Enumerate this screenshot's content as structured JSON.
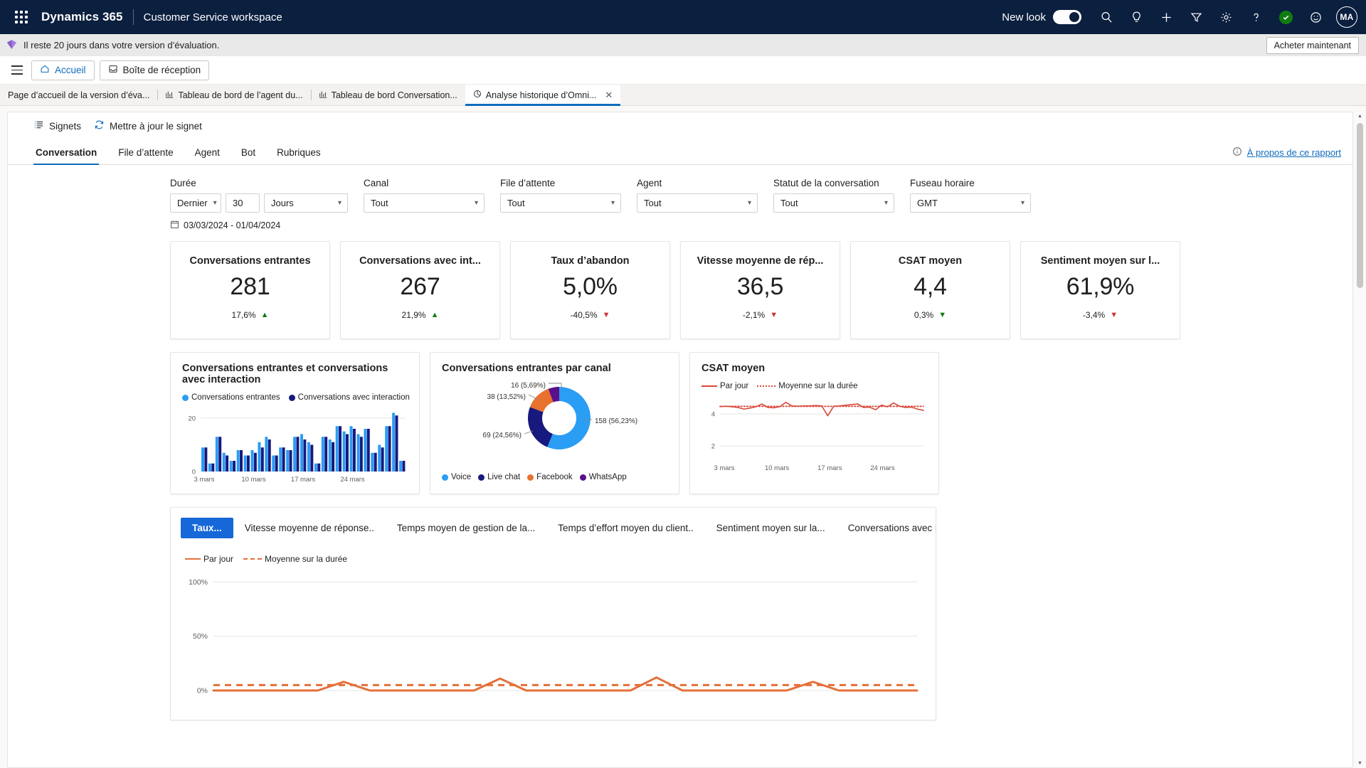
{
  "topbar": {
    "waffle_label": "app-launcher",
    "brand": "Dynamics 365",
    "app_name": "Customer Service workspace",
    "new_look_label": "New look",
    "new_look_on": true,
    "avatar_initials": "MA",
    "icons": [
      "search-icon",
      "lightbulb-icon",
      "plus-icon",
      "filter-icon",
      "gear-icon",
      "help-icon",
      "status-check-icon",
      "smiley-icon"
    ]
  },
  "trial": {
    "message": "Il reste 20 jours dans votre version d’évaluation.",
    "buy_label": "Acheter maintenant"
  },
  "appnav": {
    "home_label": "Accueil",
    "inbox_label": "Boîte de réception"
  },
  "session_tabs": [
    {
      "label": "Page d’accueil de la version d’éva...",
      "icon": "",
      "active": false,
      "closable": false
    },
    {
      "label": "Tableau de bord de l’agent du...",
      "icon": "dashboard-icon",
      "active": false,
      "closable": false
    },
    {
      "label": "Tableau de bord Conversation...",
      "icon": "dashboard-icon",
      "active": false,
      "closable": false
    },
    {
      "label": "Analyse historique d’Omni...",
      "icon": "analytics-icon",
      "active": true,
      "closable": true
    }
  ],
  "commandbar": {
    "bookmarks_label": "Signets",
    "refresh_label": "Mettre à jour le signet"
  },
  "report_tabs": [
    {
      "label": "Conversation",
      "active": true
    },
    {
      "label": "File d’attente",
      "active": false
    },
    {
      "label": "Agent",
      "active": false
    },
    {
      "label": "Bot",
      "active": false
    },
    {
      "label": "Rubriques",
      "active": false
    }
  ],
  "about_report": "À propos de ce rapport",
  "filters": {
    "duration": {
      "label": "Durée",
      "relative": "Dernier",
      "amount": "30",
      "unit": "Jours"
    },
    "channel": {
      "label": "Canal",
      "value": "Tout"
    },
    "queue": {
      "label": "File d’attente",
      "value": "Tout"
    },
    "agent": {
      "label": "Agent",
      "value": "Tout"
    },
    "status": {
      "label": "Statut de la conversation",
      "value": "Tout"
    },
    "timezone": {
      "label": "Fuseau horaire",
      "value": "GMT"
    },
    "date_range": "03/03/2024 - 01/04/2024"
  },
  "kpis": [
    {
      "title": "Conversations entrantes",
      "value": "281",
      "delta": "17,6%",
      "direction": "up",
      "arrow": "▲"
    },
    {
      "title": "Conversations avec int...",
      "value": "267",
      "delta": "21,9%",
      "direction": "up",
      "arrow": "▲"
    },
    {
      "title": "Taux d’abandon",
      "value": "5,0%",
      "delta": "-40,5%",
      "direction": "down-red",
      "arrow": "▼"
    },
    {
      "title": "Vitesse moyenne de rép...",
      "value": "36,5",
      "delta": "-2,1%",
      "direction": "down-red",
      "arrow": "▼"
    },
    {
      "title": "CSAT moyen",
      "value": "4,4",
      "delta": "0,3%",
      "direction": "down-green",
      "arrow": "▼"
    },
    {
      "title": "Sentiment moyen sur l...",
      "value": "61,9%",
      "delta": "-3,4%",
      "direction": "down-red",
      "arrow": "▼"
    }
  ],
  "colors": {
    "accent": "#0f6cbd",
    "series_light_blue": "#2a9df4",
    "series_dark_blue": "#17197e",
    "series_orange": "#e8712e",
    "series_purple": "#5c0f8b",
    "line_red": "#d9483b",
    "line_orange": "#e4703a",
    "up_green": "#107c10",
    "down_red": "#d13438",
    "pivot_active": "#1668d8",
    "topbar_bg": "#0b1f3f"
  },
  "chart_data": [
    {
      "type": "bar",
      "title": "Conversations entrantes et conversations avec interaction",
      "xlabel": "",
      "ylabel": "",
      "ylim": [
        0,
        24
      ],
      "yticks": [
        "0",
        "20"
      ],
      "grid": true,
      "legend_position": "top",
      "categories": [
        "3 mars",
        "4 mars",
        "5 mars",
        "6 mars",
        "7 mars",
        "8 mars",
        "9 mars",
        "10 mars",
        "11 mars",
        "12 mars",
        "13 mars",
        "14 mars",
        "15 mars",
        "16 mars",
        "17 mars",
        "18 mars",
        "19 mars",
        "20 mars",
        "21 mars",
        "22 mars",
        "23 mars",
        "24 mars",
        "25 mars",
        "26 mars",
        "27 mars",
        "28 mars",
        "29 mars",
        "30 mars"
      ],
      "tick_labels": [
        "3 mars",
        "10 mars",
        "17 mars",
        "24 mars"
      ],
      "series": [
        {
          "name": "Conversations entrantes",
          "color": "#2a9df4",
          "values": [
            9,
            3,
            13,
            7,
            4,
            8,
            6,
            8,
            11,
            13,
            6,
            9,
            8,
            13,
            14,
            11,
            3,
            13,
            12,
            17,
            15,
            17,
            14,
            16,
            7,
            10,
            17,
            22,
            4
          ]
        },
        {
          "name": "Conversations avec interaction",
          "color": "#17197e",
          "values": [
            9,
            3,
            13,
            6,
            4,
            8,
            6,
            7,
            9,
            12,
            6,
            9,
            8,
            13,
            12,
            10,
            3,
            13,
            11,
            17,
            14,
            16,
            13,
            16,
            7,
            9,
            17,
            21,
            4
          ]
        }
      ]
    },
    {
      "type": "pie",
      "title": "Conversations entrantes par canal",
      "donut": true,
      "legend_position": "bottom",
      "labels": [
        "Voice",
        "Live chat",
        "Facebook",
        "WhatsApp"
      ],
      "values": [
        158,
        69,
        38,
        16
      ],
      "percents": [
        "56,23%",
        "24,56%",
        "13,52%",
        "5,69%"
      ],
      "data_labels": [
        "158 (56,23%)",
        "69 (24,56%)",
        "38 (13,52%)",
        "16 (5,69%)"
      ],
      "colors": [
        "#2a9df4",
        "#17197e",
        "#e8712e",
        "#5c0f8b"
      ]
    },
    {
      "type": "line",
      "title": "CSAT moyen",
      "ylim": [
        1.2,
        5.2
      ],
      "yticks": [
        "2",
        "4"
      ],
      "tick_labels": [
        "3 mars",
        "10 mars",
        "17 mars",
        "24 mars"
      ],
      "legend_position": "top",
      "series": [
        {
          "name": "Par jour",
          "style": "solid",
          "color": "#d9483b",
          "values": [
            4.45,
            4.48,
            4.44,
            4.4,
            4.3,
            4.36,
            4.44,
            4.62,
            4.4,
            4.38,
            4.45,
            4.72,
            4.5,
            4.48,
            4.5,
            4.5,
            4.52,
            4.5,
            3.88,
            4.48,
            4.5,
            4.54,
            4.58,
            4.62,
            4.4,
            4.42,
            4.26,
            4.55,
            4.44,
            4.68,
            4.48,
            4.4,
            4.42,
            4.3,
            4.22
          ]
        },
        {
          "name": "Moyenne sur la durée",
          "style": "dotted",
          "color": "#d9483b",
          "value": 4.47
        }
      ]
    },
    {
      "type": "line",
      "title": "Taux d’abandon",
      "ylim": [
        0,
        110
      ],
      "yticks": [
        "0%",
        "50%",
        "100%"
      ],
      "legend_position": "top",
      "series": [
        {
          "name": "Par jour",
          "style": "solid",
          "color": "#e4703a",
          "values": [
            0,
            0,
            0,
            0,
            0,
            8,
            0,
            0,
            0,
            0,
            0,
            11,
            0,
            0,
            0,
            0,
            0,
            12,
            0,
            0,
            0,
            0,
            0,
            8,
            0,
            0,
            0,
            0
          ]
        },
        {
          "name": "Moyenne sur la durée",
          "style": "dashed",
          "color": "#e4703a",
          "value": 5
        }
      ]
    }
  ],
  "chart_legends": {
    "bar": [
      "Conversations entrantes",
      "Conversations avec interaction"
    ],
    "line_per_day": "Par jour",
    "line_average": "Moyenne sur la durée"
  },
  "bottom_pivots": [
    {
      "label": "Taux...",
      "active": true
    },
    {
      "label": "Vitesse moyenne de réponse..",
      "active": false
    },
    {
      "label": "Temps moyen de gestion de la...",
      "active": false
    },
    {
      "label": "Temps d’effort moyen du client..",
      "active": false
    },
    {
      "label": "Sentiment moyen sur la...",
      "active": false
    },
    {
      "label": "Conversations avec un canal secondaire",
      "active": false
    }
  ]
}
